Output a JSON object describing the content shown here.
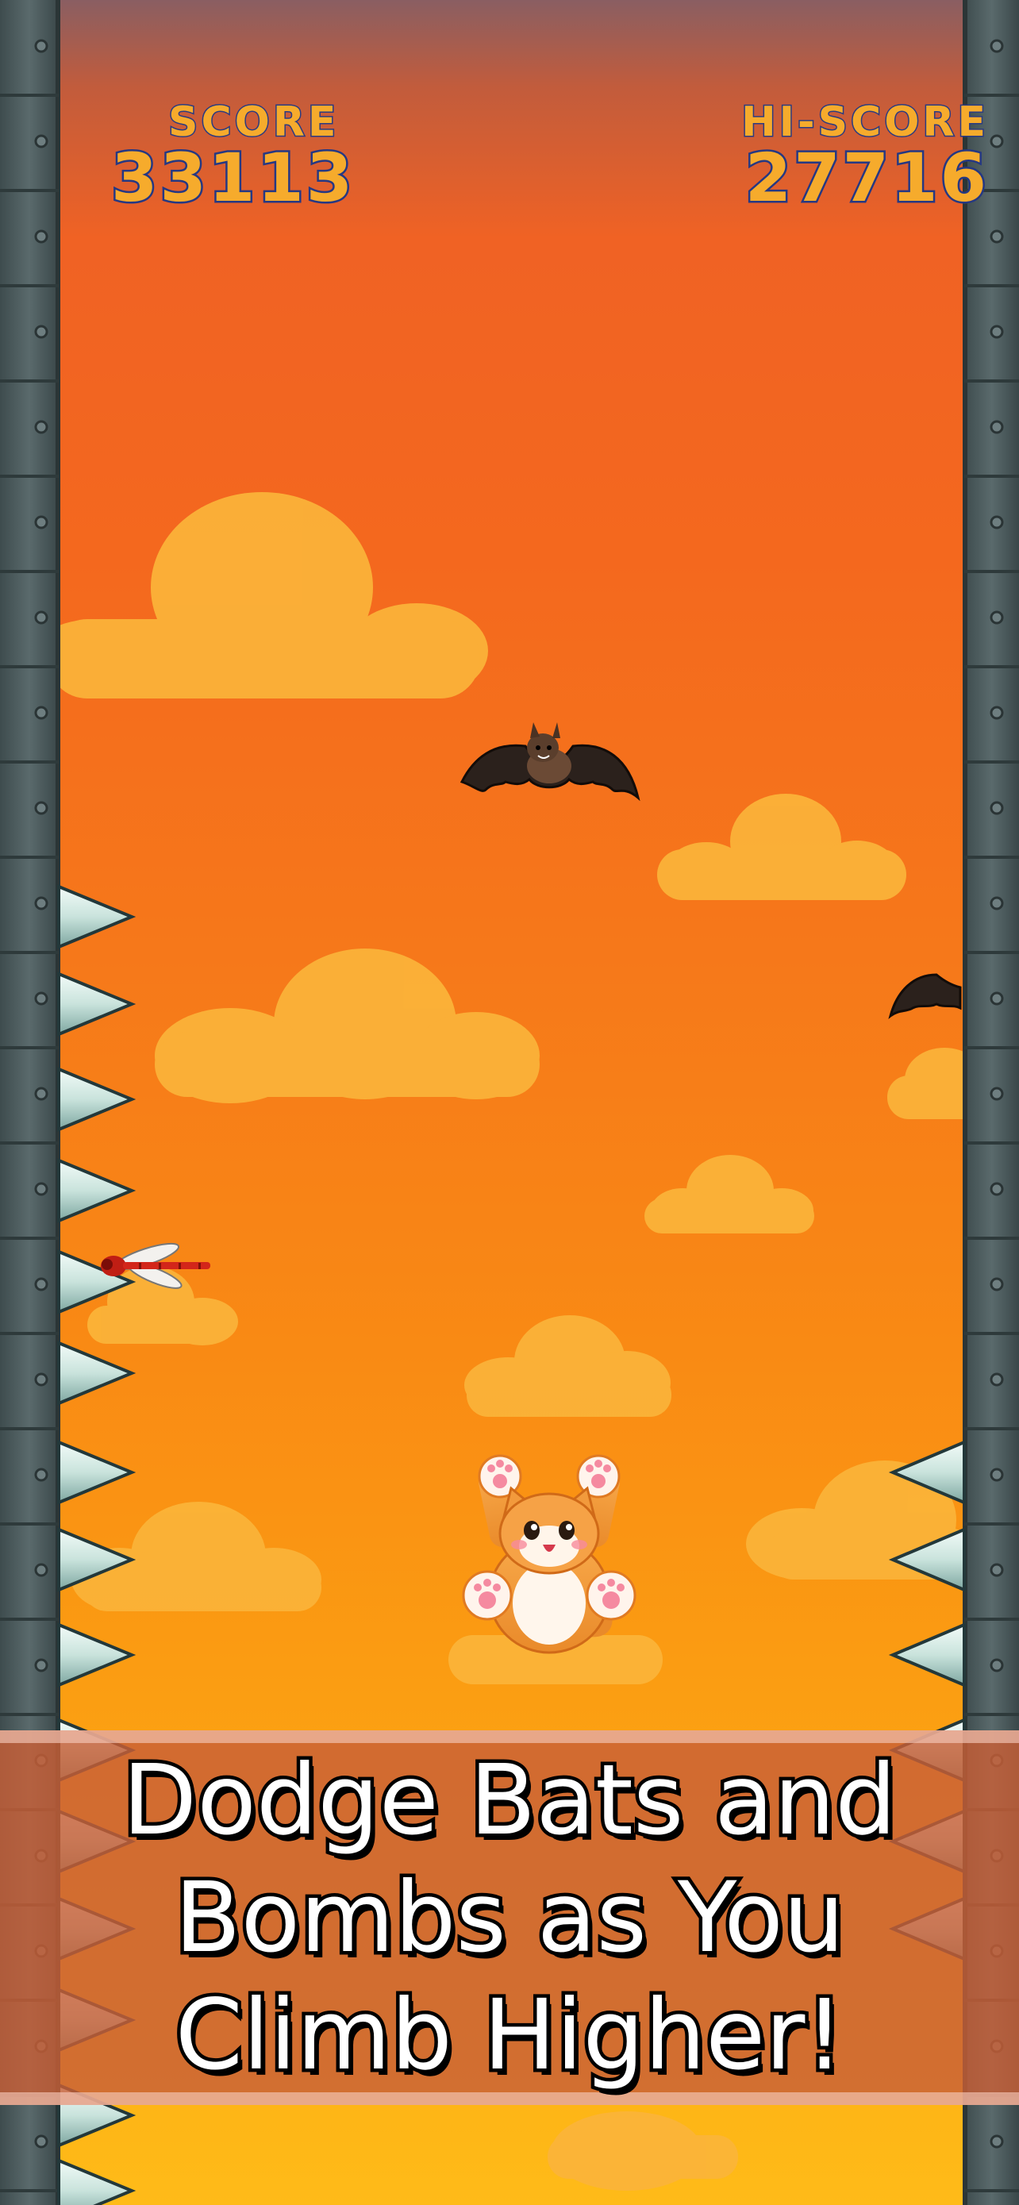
{
  "hud": {
    "score_label": "SCORE",
    "score_value": "33113",
    "hiscore_label": "HI-SCORE",
    "hiscore_value": "27716"
  },
  "promo": {
    "caption": "Dodge Bats and\nBombs as You\nClimb Higher!"
  },
  "colors": {
    "sky_top": "#8a5e62",
    "sky_mid": "#f4681e",
    "sky_bottom": "#ffbb18",
    "cloud": "#fbb43a",
    "wall_metal": "#4a5a5c",
    "spike": "#d8ece6",
    "hud_text": "#f6ab2c",
    "hud_outline": "#253883",
    "banner": "#c85f37"
  },
  "sprites": {
    "player": "orange-cat",
    "enemies": [
      "bat",
      "bat",
      "red-dragonfly"
    ],
    "hazards": [
      "wall-spikes-left",
      "wall-spikes-right"
    ]
  }
}
